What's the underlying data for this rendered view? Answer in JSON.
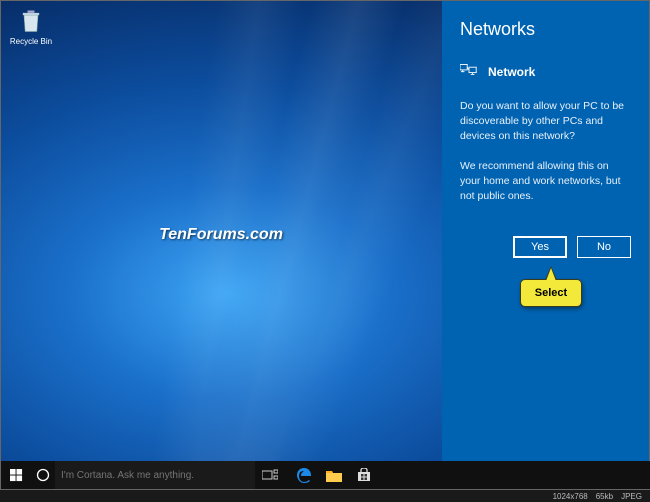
{
  "desktop": {
    "recycle_bin_label": "Recycle Bin",
    "watermark": "TenForums.com"
  },
  "network_panel": {
    "title": "Networks",
    "network_label": "Network",
    "prompt1": "Do you want to allow your PC to be discoverable by other PCs and devices on this network?",
    "prompt2": "We recommend allowing this on your home and work networks, but not public ones.",
    "yes_label": "Yes",
    "no_label": "No"
  },
  "callout": {
    "label": "Select"
  },
  "taskbar": {
    "cortana_placeholder": "I'm Cortana. Ask me anything."
  },
  "footer": {
    "dimensions": "1024x768",
    "size": "65kb",
    "format": "JPEG"
  }
}
